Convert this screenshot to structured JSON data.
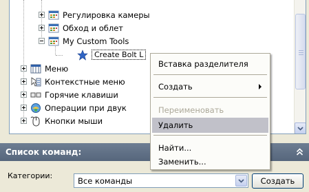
{
  "tree": {
    "nodes": [
      {
        "label": "Регулировка камеры",
        "expander": "plus",
        "icon": "toolbar-icon"
      },
      {
        "label": "Обход и облет",
        "expander": "plus",
        "icon": "toolbar-icon"
      },
      {
        "label": "My Custom Tools",
        "expander": "minus",
        "icon": "toolbar-icon"
      },
      {
        "label": "Create Bolt L",
        "expander": "none",
        "icon": "star-icon"
      },
      {
        "label": "Меню",
        "expander": "plus",
        "icon": "menu-icon"
      },
      {
        "label": "Контекстные меню",
        "expander": "plus",
        "icon": "context-menu-icon"
      },
      {
        "label": "Горячие клавиши",
        "expander": "plus",
        "icon": "keyboard-icon"
      },
      {
        "label": "Операции при двук",
        "expander": "plus",
        "icon": "double-click-icon"
      },
      {
        "label": "Кнопки мыши",
        "expander": "plus",
        "icon": "mouse-icon"
      }
    ]
  },
  "context_menu": {
    "items": [
      {
        "label": "Вставка разделителя",
        "state": "normal"
      },
      {
        "label": "Создать",
        "state": "submenu"
      },
      {
        "label": "Переименовать",
        "state": "disabled"
      },
      {
        "label": "Удалить",
        "state": "highlighted"
      },
      {
        "label": "Найти...",
        "state": "normal"
      },
      {
        "label": "Заменить...",
        "state": "normal"
      }
    ]
  },
  "commands": {
    "header": "Список команд:",
    "category_label": "Категории:",
    "category_value": "Все команды",
    "create_button": "Создать"
  },
  "colors": {
    "header_bg": "#5f6f86",
    "menu_highlight": "#c1c1c9",
    "panel_bg": "#ece9d8"
  }
}
